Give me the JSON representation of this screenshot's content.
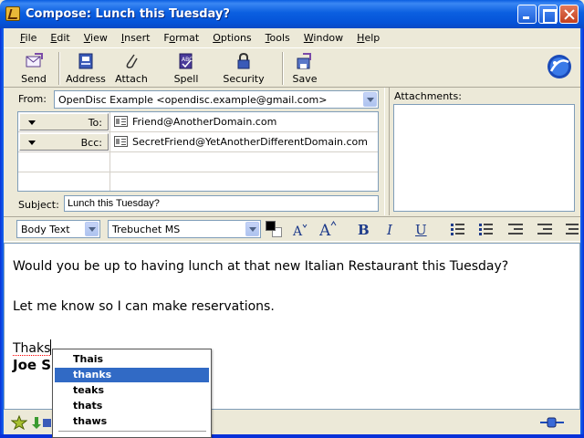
{
  "window": {
    "title": "Compose: Lunch this Tuesday?"
  },
  "menu": [
    {
      "label": "File",
      "key": "F",
      "rest": "ile"
    },
    {
      "label": "Edit",
      "key": "E",
      "rest": "dit"
    },
    {
      "label": "View",
      "key": "V",
      "rest": "iew"
    },
    {
      "label": "Insert",
      "key": "I",
      "rest": "nsert"
    },
    {
      "label": "Format",
      "pre": "F",
      "key": "o",
      "rest": "rmat"
    },
    {
      "label": "Options",
      "key": "O",
      "rest": "ptions"
    },
    {
      "label": "Tools",
      "key": "T",
      "rest": "ools"
    },
    {
      "label": "Window",
      "key": "W",
      "rest": "indow"
    },
    {
      "label": "Help",
      "key": "H",
      "rest": "elp"
    }
  ],
  "toolbar": {
    "send": "Send",
    "address": "Address",
    "attach": "Attach",
    "spell": "Spell",
    "security": "Security",
    "save": "Save"
  },
  "header": {
    "from_label": "From:",
    "from_value": "OpenDisc Example <opendisc.example@gmail.com>",
    "to_label": "To:",
    "to_value": "Friend@AnotherDomain.com",
    "bcc_label": "Bcc:",
    "bcc_value": "SecretFriend@YetAnotherDifferentDomain.com",
    "subject_label": "Subject:",
    "subject_value": "Lunch this Tuesday?"
  },
  "attachments": {
    "label": "Attachments:"
  },
  "format": {
    "paragraph_style": "Body Text",
    "font": "Trebuchet MS",
    "text_color": "#000000",
    "bg_color": "#ffffff"
  },
  "body": {
    "line1": "Would you be up to having lunch at that new Italian Restaurant this Tuesday?",
    "line2": "Let me know so I can make reservations.",
    "misspelled": "Thaks",
    "signature": "Joe S"
  },
  "spell_suggestions": {
    "items": [
      "Thais",
      "thanks",
      "teaks",
      "thats",
      "thaws"
    ],
    "selected_index": 1
  },
  "colors": {
    "accent": "#316ac5",
    "titlebar": "#0a5ee0"
  }
}
